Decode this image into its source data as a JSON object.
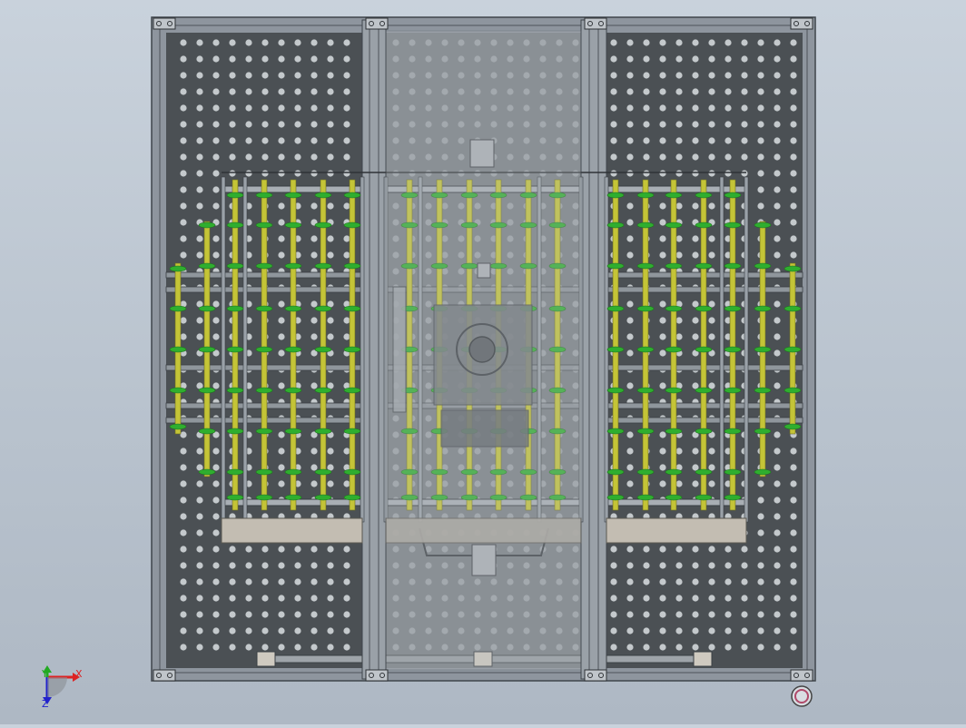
{
  "viewport": {
    "background_top": "#c9d2dc",
    "background_bottom": "#aeb8c4"
  },
  "model": {
    "frame_color": "#8e959e",
    "frame_dark": "#4d535a",
    "perforated_plate_color": "#4b5054",
    "perforation_color": "#c4c9cc",
    "center_panel_color": "#8a9095",
    "roller_color": "#c4c437",
    "roller_ring_color": "#2fae2f",
    "tray_color": "#c3bdb2",
    "marker_color": "#b04a6a"
  },
  "triad": {
    "x_label": "X",
    "y_label": "Y",
    "z_label": "Z",
    "x_color": "#d22",
    "y_color": "#2a2",
    "z_color": "#22c"
  }
}
